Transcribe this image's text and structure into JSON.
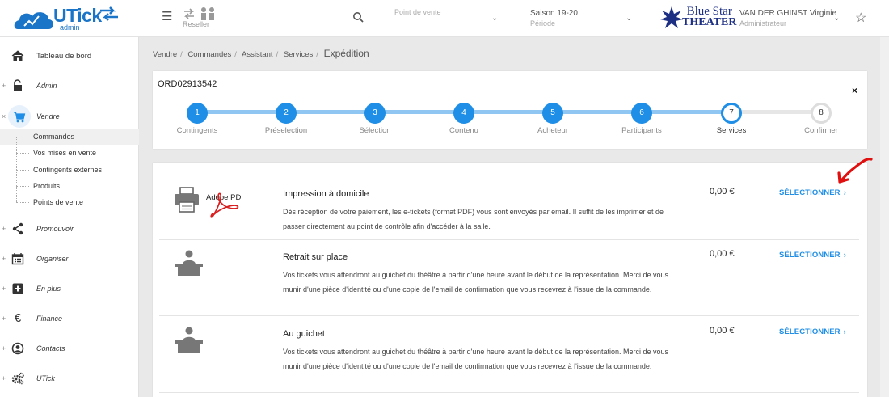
{
  "header": {
    "logo_text": "UTick",
    "logo_sub": "admin",
    "reseller_label": "Reseller",
    "point_de_vente_placeholder": "Point de vente",
    "season_label": "Saison 19-20",
    "season_sub": "Période",
    "brand_line1": "Blue Star",
    "brand_line2": "THEATER",
    "user_name": "VAN DER GHINST Virginie",
    "user_role": "Administrateur"
  },
  "sidebar": {
    "items": [
      {
        "label": "Tableau de bord",
        "icon": "home-icon"
      },
      {
        "label": "Admin",
        "icon": "lock-icon"
      },
      {
        "label": "Vendre",
        "icon": "cart-icon"
      },
      {
        "label": "Promouvoir",
        "icon": "share-icon"
      },
      {
        "label": "Organiser",
        "icon": "calendar-icon"
      },
      {
        "label": "En plus",
        "icon": "plus-square-icon"
      },
      {
        "label": "Finance",
        "icon": "euro-icon"
      },
      {
        "label": "Contacts",
        "icon": "user-circle-icon"
      },
      {
        "label": "UTick",
        "icon": "gears-icon"
      }
    ],
    "vendre_sub": [
      "Commandes",
      "Vos mises en vente",
      "Contingents externes",
      "Produits",
      "Points de vente"
    ]
  },
  "breadcrumb": {
    "items": [
      "Vendre",
      "Commandes",
      "Assistant",
      "Services"
    ],
    "current": "Expédition"
  },
  "order": {
    "id": "ORD02913542",
    "close_symbol": "×"
  },
  "steps": [
    {
      "num": "1",
      "label": "Contingents",
      "state": "done"
    },
    {
      "num": "2",
      "label": "Préselection",
      "state": "done"
    },
    {
      "num": "3",
      "label": "Sélection",
      "state": "done"
    },
    {
      "num": "4",
      "label": "Contenu",
      "state": "done"
    },
    {
      "num": "5",
      "label": "Acheteur",
      "state": "done"
    },
    {
      "num": "6",
      "label": "Participants",
      "state": "done"
    },
    {
      "num": "7",
      "label": "Services",
      "state": "current"
    },
    {
      "num": "8",
      "label": "Confirmer",
      "state": "todo"
    }
  ],
  "options": [
    {
      "title": "Impression à domicile",
      "price": "0,00 €",
      "action": "SÉLECTIONNER",
      "desc": "Dès réception de votre paiement, les e-tickets (format PDF) vous sont envoyés par email. Il suffit de les imprimer et de passer directement au point de contrôle afin d'accéder à la salle.",
      "logo_text": "Adobe PDF"
    },
    {
      "title": "Retrait sur place",
      "price": "0,00 €",
      "action": "SÉLECTIONNER",
      "desc": "Vos tickets vous attendront au guichet du théâtre à partir d'une heure avant le début de la représentation. Merci de vous munir d'une pièce d'identité ou d'une copie de l'email de confirmation que vous recevrez à l'issue de la commande."
    },
    {
      "title": "Au guichet",
      "price": "0,00 €",
      "action": "SÉLECTIONNER",
      "desc": "Vos tickets vous attendront au guichet du théâtre à partir d'une heure avant le début de la représentation. Merci de vous munir d'une pièce d'identité ou d'une copie de l'email de confirmation que vous recevrez à l'issue de la commande."
    }
  ],
  "colors": {
    "accent": "#1f8ee6",
    "brand": "#1a74c8",
    "annotation_arrow": "#e01010"
  }
}
